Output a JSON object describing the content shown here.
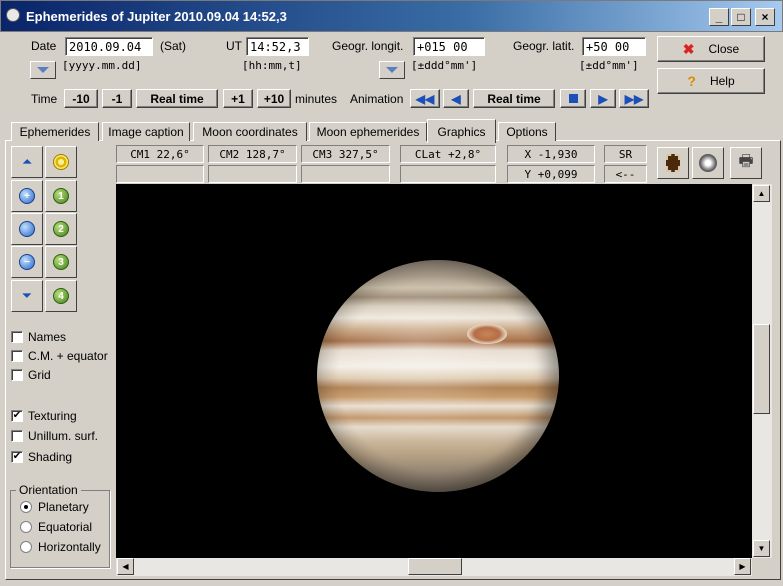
{
  "window": {
    "title": "Ephemerides of Jupiter  2010.09.04  14:52,3",
    "minimize": "_",
    "maximize": "□",
    "close": "×"
  },
  "date": {
    "label": "Date",
    "value": "2010.09.04",
    "weekday": "(Sat)",
    "format": "[yyyy.mm.dd]"
  },
  "ut": {
    "label": "UT",
    "value": "14:52,3",
    "format": "[hh:mm,t]"
  },
  "longitude": {
    "label": "Geogr. longit.",
    "value": "+015 00",
    "format": "[±ddd°mm']"
  },
  "latitude": {
    "label": "Geogr. latit.",
    "value": "+50 00",
    "format": "[±dd°mm']"
  },
  "buttons": {
    "close": "Close",
    "help": "Help"
  },
  "time_controls": {
    "label": "Time",
    "minus10": "-10",
    "minus1": "-1",
    "real_time": "Real time",
    "plus1": "+1",
    "plus10": "+10",
    "units": "minutes"
  },
  "animation": {
    "label": "Animation",
    "real_time": "Real time"
  },
  "tabs": [
    "Ephemerides",
    "Image caption",
    "Moon coordinates",
    "Moon ephemerides",
    "Graphics",
    "Options"
  ],
  "active_tab": "Graphics",
  "info": {
    "cm1": "CM1  22,6°",
    "cm2": "CM2 128,7°",
    "cm3": "CM3 327,5°",
    "clat": "CLat  +2,8°",
    "x": "X  -1,930",
    "y": "Y  +0,099",
    "sr": "SR",
    "back": "<--"
  },
  "moon_buttons": [
    "1",
    "2",
    "3",
    "4"
  ],
  "options": {
    "names": "Names",
    "cm_equator": "C.M. + equator",
    "grid": "Grid",
    "texturing": "Texturing",
    "unillum": "Unillum. surf.",
    "shading": "Shading"
  },
  "checked": {
    "names": false,
    "cm_equator": false,
    "grid": false,
    "texturing": true,
    "unillum": false,
    "shading": true
  },
  "orientation": {
    "legend": "Orientation",
    "planetary": "Planetary",
    "equatorial": "Equatorial",
    "horizontally": "Horizontally",
    "selected": "Planetary"
  },
  "colors": {
    "title_start": "#0a246a",
    "title_end": "#a6caf0",
    "face": "#d4d0c8",
    "canvas": "#000000",
    "accent_blue": "#1c4fb8"
  }
}
